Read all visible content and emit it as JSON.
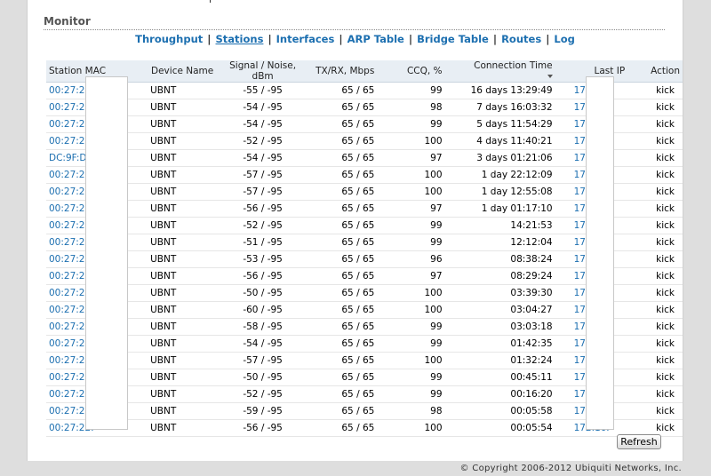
{
  "monitor_title": "Monitor",
  "nav": {
    "throughput": "Throughput",
    "stations": "Stations",
    "interfaces": "Interfaces",
    "arp_table": "ARP Table",
    "bridge_table": "Bridge Table",
    "routes": "Routes",
    "log": "Log",
    "separator": "|"
  },
  "table": {
    "headers": {
      "mac": "Station MAC",
      "device": "Device Name",
      "signal": "Signal / Noise, dBm",
      "txrx": "TX/RX, Mbps",
      "ccq": "CCQ, %",
      "time": "Connection Time",
      "ip": "Last IP",
      "action": "Action"
    },
    "rows": [
      {
        "mac": "00:27:22:",
        "device": "UBNT",
        "signal": "-55 / -95",
        "txrx": "65 / 65",
        "ccq": "99",
        "time": "16 days 13:29:49",
        "ip": "172.16.",
        "action": "kick"
      },
      {
        "mac": "00:27:22:",
        "device": "UBNT",
        "signal": "-54 / -95",
        "txrx": "65 / 65",
        "ccq": "98",
        "time": "7 days 16:03:32",
        "ip": "172.16.",
        "action": "kick"
      },
      {
        "mac": "00:27:22:",
        "device": "UBNT",
        "signal": "-54 / -95",
        "txrx": "65 / 65",
        "ccq": "99",
        "time": "5 days 11:54:29",
        "ip": "172.16.",
        "action": "kick"
      },
      {
        "mac": "00:27:22:",
        "device": "UBNT",
        "signal": "-52 / -95",
        "txrx": "65 / 65",
        "ccq": "100",
        "time": "4 days 11:40:21",
        "ip": "172.16.",
        "action": "kick"
      },
      {
        "mac": "DC:9F:DB",
        "device": "UBNT",
        "signal": "-54 / -95",
        "txrx": "65 / 65",
        "ccq": "97",
        "time": "3 days 01:21:06",
        "ip": "172.16.",
        "action": "kick"
      },
      {
        "mac": "00:27:22:",
        "device": "UBNT",
        "signal": "-57 / -95",
        "txrx": "65 / 65",
        "ccq": "100",
        "time": "1 day 22:12:09",
        "ip": "172.16.",
        "action": "kick"
      },
      {
        "mac": "00:27:22:",
        "device": "UBNT",
        "signal": "-57 / -95",
        "txrx": "65 / 65",
        "ccq": "100",
        "time": "1 day 12:55:08",
        "ip": "172.16.",
        "action": "kick"
      },
      {
        "mac": "00:27:22:",
        "device": "UBNT",
        "signal": "-56 / -95",
        "txrx": "65 / 65",
        "ccq": "97",
        "time": "1 day 01:17:10",
        "ip": "172.16.",
        "action": "kick"
      },
      {
        "mac": "00:27:22:",
        "device": "UBNT",
        "signal": "-52 / -95",
        "txrx": "65 / 65",
        "ccq": "99",
        "time": "14:21:53",
        "ip": "172.16.",
        "action": "kick"
      },
      {
        "mac": "00:27:22:",
        "device": "UBNT",
        "signal": "-51 / -95",
        "txrx": "65 / 65",
        "ccq": "99",
        "time": "12:12:04",
        "ip": "172.16.",
        "action": "kick"
      },
      {
        "mac": "00:27:22:",
        "device": "UBNT",
        "signal": "-53 / -95",
        "txrx": "65 / 65",
        "ccq": "96",
        "time": "08:38:24",
        "ip": "172.16.",
        "action": "kick"
      },
      {
        "mac": "00:27:22:",
        "device": "UBNT",
        "signal": "-56 / -95",
        "txrx": "65 / 65",
        "ccq": "97",
        "time": "08:29:24",
        "ip": "172.16.",
        "action": "kick"
      },
      {
        "mac": "00:27:22:",
        "device": "UBNT",
        "signal": "-50 / -95",
        "txrx": "65 / 65",
        "ccq": "100",
        "time": "03:39:30",
        "ip": "172.16.",
        "action": "kick"
      },
      {
        "mac": "00:27:22:",
        "device": "UBNT",
        "signal": "-60 / -95",
        "txrx": "65 / 65",
        "ccq": "100",
        "time": "03:04:27",
        "ip": "172.16.",
        "action": "kick"
      },
      {
        "mac": "00:27:22:",
        "device": "UBNT",
        "signal": "-58 / -95",
        "txrx": "65 / 65",
        "ccq": "99",
        "time": "03:03:18",
        "ip": "172.16.",
        "action": "kick"
      },
      {
        "mac": "00:27:22:",
        "device": "UBNT",
        "signal": "-54 / -95",
        "txrx": "65 / 65",
        "ccq": "99",
        "time": "01:42:35",
        "ip": "172.16.",
        "action": "kick"
      },
      {
        "mac": "00:27:22:",
        "device": "UBNT",
        "signal": "-57 / -95",
        "txrx": "65 / 65",
        "ccq": "100",
        "time": "01:32:24",
        "ip": "172.16.",
        "action": "kick"
      },
      {
        "mac": "00:27:22:",
        "device": "UBNT",
        "signal": "-50 / -95",
        "txrx": "65 / 65",
        "ccq": "99",
        "time": "00:45:11",
        "ip": "172.16.",
        "action": "kick"
      },
      {
        "mac": "00:27:22:",
        "device": "UBNT",
        "signal": "-52 / -95",
        "txrx": "65 / 65",
        "ccq": "99",
        "time": "00:16:20",
        "ip": "172.16.",
        "action": "kick"
      },
      {
        "mac": "00:27:22:",
        "device": "UBNT",
        "signal": "-59 / -95",
        "txrx": "65 / 65",
        "ccq": "98",
        "time": "00:05:58",
        "ip": "172.16.",
        "action": "kick"
      },
      {
        "mac": "00:27:22:",
        "device": "UBNT",
        "signal": "-56 / -95",
        "txrx": "65 / 65",
        "ccq": "100",
        "time": "00:05:54",
        "ip": "172.16.",
        "action": "kick"
      }
    ]
  },
  "refresh_label": "Refresh",
  "copyright": "© Copyright 2006-2012 Ubiquiti Networks, Inc.",
  "colors": {
    "link": "#1c6fb0",
    "header_bg": "#e8eef4",
    "page_bg": "#dedede"
  }
}
